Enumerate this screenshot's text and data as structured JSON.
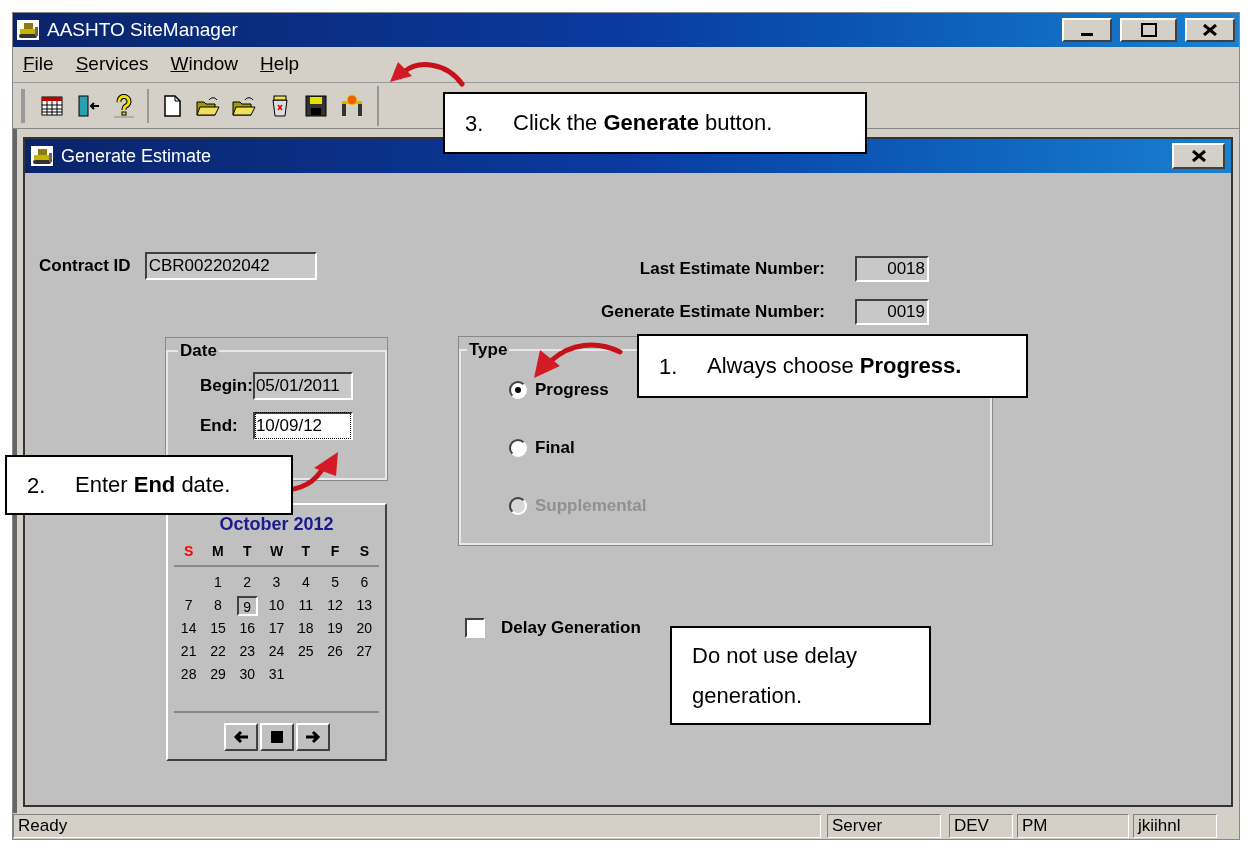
{
  "window": {
    "title": "AASHTO SiteManager"
  },
  "menu": [
    "File",
    "Services",
    "Window",
    "Help"
  ],
  "toolbar": [
    {
      "kind": "grid"
    },
    {
      "kind": "door"
    },
    {
      "kind": "help"
    },
    {
      "kind": "new"
    },
    {
      "kind": "open"
    },
    {
      "kind": "open2"
    },
    {
      "kind": "trash"
    },
    {
      "kind": "save"
    },
    {
      "kind": "generate"
    }
  ],
  "dialog": {
    "title": "Generate Estimate",
    "contract": {
      "label": "Contract ID",
      "value": "CBR002202042"
    },
    "numbers": [
      {
        "label": "Last Estimate Number:",
        "value": "0018"
      },
      {
        "label": "Generate Estimate Number:",
        "value": "0019"
      }
    ],
    "date_group": {
      "title": "Date",
      "fields": [
        {
          "label": "Begin:",
          "value": "05/01/2011",
          "focused": false
        },
        {
          "label": "End:",
          "value": "10/09/12",
          "focused": true
        }
      ]
    },
    "calendar": {
      "title": "October 2012",
      "weekdays": [
        {
          "label": "S",
          "color": "#ff0000"
        },
        {
          "label": "M",
          "color": "#000000"
        },
        {
          "label": "T",
          "color": "#000000"
        },
        {
          "label": "W",
          "color": "#000000"
        },
        {
          "label": "T",
          "color": "#000000"
        },
        {
          "label": "F",
          "color": "#000000"
        },
        {
          "label": "S",
          "color": "#000000"
        }
      ],
      "weeks": [
        [
          {
            "day": "1",
            "selected": false
          },
          {
            "day": "2",
            "selected": false
          },
          {
            "day": "3",
            "selected": false
          },
          {
            "day": "4",
            "selected": false
          },
          {
            "day": "5",
            "selected": false
          },
          {
            "day": "6",
            "selected": false
          }
        ],
        [
          {
            "day": "7",
            "selected": false
          },
          {
            "day": "8",
            "selected": false
          },
          {
            "day": "9",
            "selected": true
          },
          {
            "day": "10",
            "selected": false
          },
          {
            "day": "11",
            "selected": false
          },
          {
            "day": "12",
            "selected": false
          },
          {
            "day": "13",
            "selected": false
          }
        ],
        [
          {
            "day": "14",
            "selected": false
          },
          {
            "day": "15",
            "selected": false
          },
          {
            "day": "16",
            "selected": false
          },
          {
            "day": "17",
            "selected": false
          },
          {
            "day": "18",
            "selected": false
          },
          {
            "day": "19",
            "selected": false
          },
          {
            "day": "20",
            "selected": false
          }
        ],
        [
          {
            "day": "21",
            "selected": false
          },
          {
            "day": "22",
            "selected": false
          },
          {
            "day": "23",
            "selected": false
          },
          {
            "day": "24",
            "selected": false
          },
          {
            "day": "25",
            "selected": false
          },
          {
            "day": "26",
            "selected": false
          },
          {
            "day": "27",
            "selected": false
          }
        ],
        [
          {
            "day": "28",
            "selected": false
          },
          {
            "day": "29",
            "selected": false
          },
          {
            "day": "30",
            "selected": false
          },
          {
            "day": "31",
            "selected": false
          }
        ]
      ],
      "nav": [
        {
          "kind": "prev"
        },
        {
          "kind": "today"
        },
        {
          "kind": "next"
        }
      ]
    },
    "type_group": {
      "title": "Type",
      "options": [
        {
          "label": "Progress",
          "selected": true,
          "disabled": false
        },
        {
          "label": "Final",
          "selected": false,
          "disabled": false
        },
        {
          "label": "Supplemental",
          "selected": false,
          "disabled": true
        }
      ]
    },
    "delay": {
      "label": "Delay Generation",
      "checked": false
    }
  },
  "callouts": [
    {
      "kind": "toolbar",
      "number": "3.",
      "text": "Click the **Generate** button."
    },
    {
      "kind": "type",
      "number": "1.",
      "text": "Always choose **Progress.**"
    },
    {
      "kind": "date",
      "number": "2.",
      "text": "Enter **End** date."
    },
    {
      "kind": "delay",
      "text": "Do not use delay generation."
    }
  ],
  "status_bar": [
    "Ready",
    "Server",
    "DEV",
    "PM",
    "jkiihnl"
  ]
}
